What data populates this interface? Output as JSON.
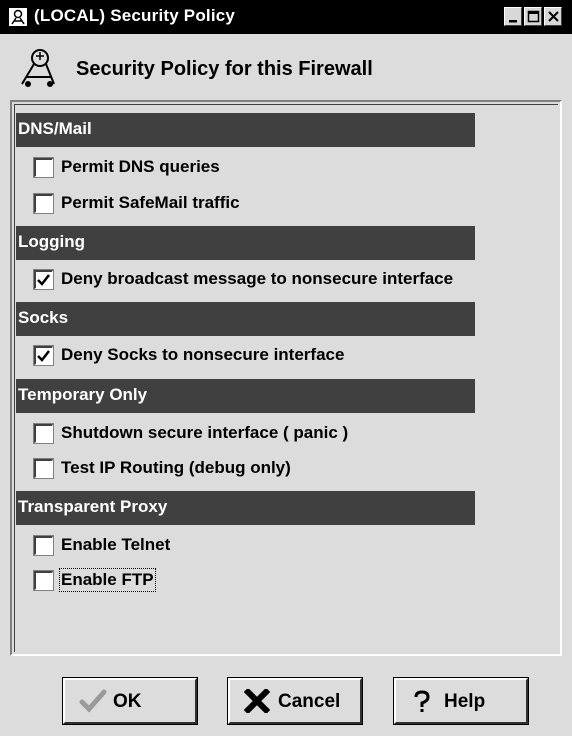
{
  "window": {
    "title": "(LOCAL) Security Policy",
    "icon": "window-system-icon",
    "controls": [
      "minimize-icon",
      "maximize-icon",
      "close-icon"
    ]
  },
  "header": {
    "icon": "security-policy-icon",
    "title": "Security Policy for this Firewall"
  },
  "sections": [
    {
      "title": "DNS/Mail",
      "options": [
        {
          "label": "Permit DNS queries",
          "checked": false
        },
        {
          "label": "Permit SafeMail traffic",
          "checked": false
        }
      ]
    },
    {
      "title": "Logging",
      "options": [
        {
          "label": "Deny broadcast message to nonsecure interface",
          "checked": true
        }
      ]
    },
    {
      "title": "Socks",
      "options": [
        {
          "label": "Deny Socks to nonsecure interface",
          "checked": true
        }
      ]
    },
    {
      "title": "Temporary Only",
      "options": [
        {
          "label": "Shutdown secure interface ( panic )",
          "checked": false
        },
        {
          "label": "Test IP Routing (debug only)",
          "checked": false
        }
      ]
    },
    {
      "title": "Transparent Proxy",
      "options": [
        {
          "label": "Enable Telnet",
          "checked": false
        },
        {
          "label": "Enable FTP",
          "checked": false
        }
      ]
    }
  ],
  "buttons": {
    "ok": {
      "label": "OK",
      "icon": "checkmark-icon"
    },
    "cancel": {
      "label": "Cancel",
      "icon": "x-icon"
    },
    "help": {
      "label": "Help",
      "icon": "question-icon"
    }
  },
  "colors": {
    "section_header_bg": "#404040",
    "window_bg": "#dcdcdc",
    "titlebar_bg": "#000000"
  }
}
